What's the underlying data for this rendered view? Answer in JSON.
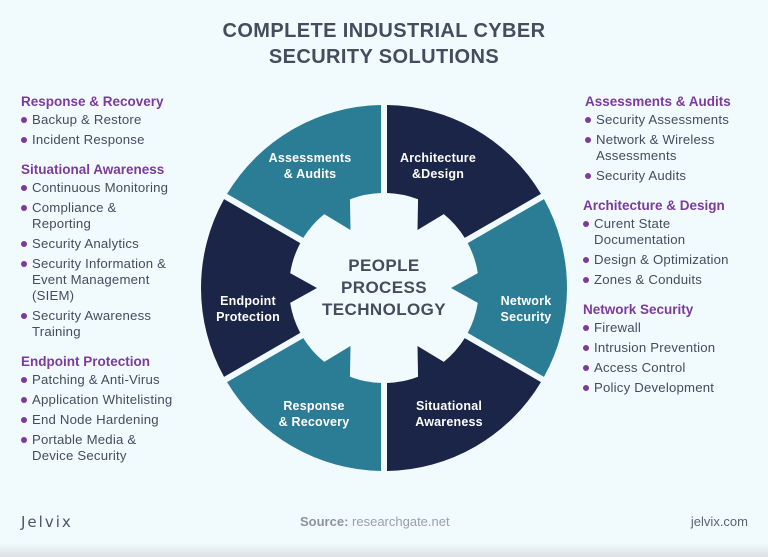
{
  "title": {
    "line1": "COMPLETE INDUSTRIAL CYBER",
    "line2": "SECURITY SOLUTIONS"
  },
  "colors": {
    "background": "#f1fbfe",
    "teal": "#2b7d96",
    "navy": "#1a2548",
    "accent_purple": "#7a3b9c",
    "text_dark": "#434d5e"
  },
  "left_sections": [
    {
      "title": "Response & Recovery",
      "items": [
        "Backup & Restore",
        "Incident Response"
      ]
    },
    {
      "title": "Situational Awareness",
      "items": [
        "Continuous Monitoring",
        "Compliance & Reporting",
        "Security Analytics",
        "Security Information & Event Management (SIEM)",
        "Security Awareness Training"
      ]
    },
    {
      "title": "Endpoint Protection",
      "items": [
        "Patching & Anti-Virus",
        "Application Whitelisting",
        "End Node Hardening",
        "Portable Media & Device Security"
      ]
    }
  ],
  "right_sections": [
    {
      "title": "Assessments & Audits",
      "items": [
        "Security Assessments",
        "Network & Wireless Assessments",
        "Security Audits"
      ]
    },
    {
      "title": "Architecture & Design",
      "items": [
        "Curent State Documentation",
        "Design & Optimization",
        "Zones & Conduits"
      ]
    },
    {
      "title": "Network Security",
      "items": [
        "Firewall",
        "Intrusion Prevention",
        "Access Control",
        "Policy Development"
      ]
    }
  ],
  "wheel": {
    "center_lines": [
      "PEOPLE",
      "PROCESS",
      "TECHNOLOGY"
    ],
    "segments": [
      {
        "label_lines": [
          "Architecture",
          "&Design"
        ],
        "color": "navy"
      },
      {
        "label_lines": [
          "Network",
          "Security"
        ],
        "color": "teal"
      },
      {
        "label_lines": [
          "Situational",
          "Awareness"
        ],
        "color": "navy"
      },
      {
        "label_lines": [
          "Response",
          "& Recovery"
        ],
        "color": "teal"
      },
      {
        "label_lines": [
          "Endpoint",
          "Protection"
        ],
        "color": "navy"
      },
      {
        "label_lines": [
          "Assessments",
          "& Audits"
        ],
        "color": "teal"
      }
    ]
  },
  "footer": {
    "logo": "Jelvix",
    "source_label": "Source:",
    "source_value": "researchgate.net",
    "site": "jelvix.com"
  }
}
